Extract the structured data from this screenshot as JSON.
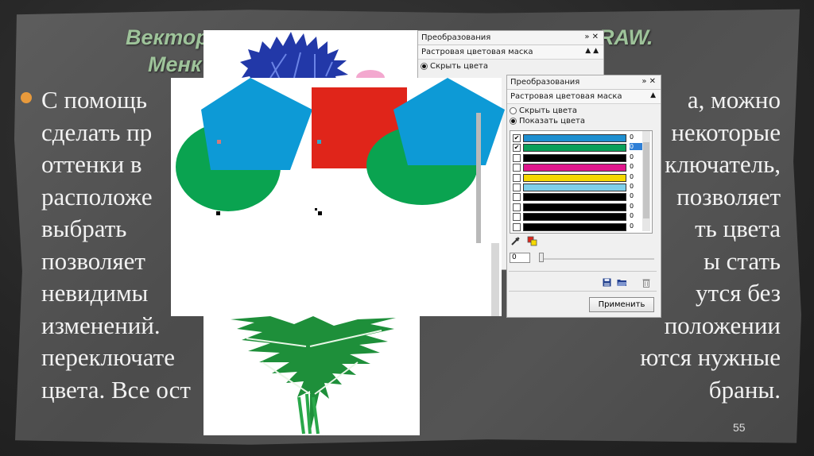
{
  "slide": {
    "title_line1": "Вектор",
    "title_line1_end": "RAW.",
    "title_line2": "Менк",
    "page_number": "55",
    "body_lines": [
      {
        "left": "С помощь",
        "right": "а, можно"
      },
      {
        "left": "сделать пр",
        "right": "некоторые"
      },
      {
        "left": "оттенки в",
        "right": "ключатель,"
      },
      {
        "left": "расположе",
        "right": "позволяет"
      },
      {
        "left": "выбрать",
        "right": "ть  цвета"
      },
      {
        "left": "позволяет",
        "right": "ы    стать"
      },
      {
        "left": "невидимы",
        "right": "утся    без"
      },
      {
        "left": "изменений.",
        "right": "положении"
      },
      {
        "left": "переключате",
        "right": "ются  нужные"
      },
      {
        "left": "цвета. Все ост",
        "right": "браны."
      }
    ]
  },
  "panel_back": {
    "title": "Преобразования",
    "subtitle": "Растровая цветовая маска",
    "option_hide": "Скрыть цвета"
  },
  "panel_front": {
    "title": "Преобразования",
    "subtitle": "Растровая цветовая маска",
    "option_hide": "Скрыть цвета",
    "option_show": "Показать цвета",
    "selected_option": "Показать цвета",
    "colors": [
      {
        "color": "#1e8fd0",
        "checked": true,
        "value": "0",
        "selected": false
      },
      {
        "color": "#0aa05a",
        "checked": true,
        "value": "0",
        "selected": true
      },
      {
        "color": "#000000",
        "checked": false,
        "value": "0",
        "selected": false
      },
      {
        "color": "#e0168c",
        "checked": false,
        "value": "0",
        "selected": false
      },
      {
        "color": "#f5d800",
        "checked": false,
        "value": "0",
        "selected": false
      },
      {
        "color": "#7fd0ea",
        "checked": false,
        "value": "0",
        "selected": false
      },
      {
        "color": "#000000",
        "checked": false,
        "value": "0",
        "selected": false
      },
      {
        "color": "#000000",
        "checked": false,
        "value": "0",
        "selected": false
      },
      {
        "color": "#000000",
        "checked": false,
        "value": "0",
        "selected": false
      },
      {
        "color": "#000000",
        "checked": false,
        "value": "0",
        "selected": false
      }
    ],
    "tolerance_value": "0",
    "apply_label": "Применить",
    "icons": {
      "eyedropper": "eyedropper-icon",
      "color_select": "color-select-icon",
      "save": "save-icon",
      "open": "open-folder-icon",
      "delete": "trash-icon"
    }
  },
  "shape_colors": {
    "blue": "#0d9ad6",
    "green": "#0aa350",
    "red": "#e0251a",
    "dark_blue": "#2238a8"
  }
}
